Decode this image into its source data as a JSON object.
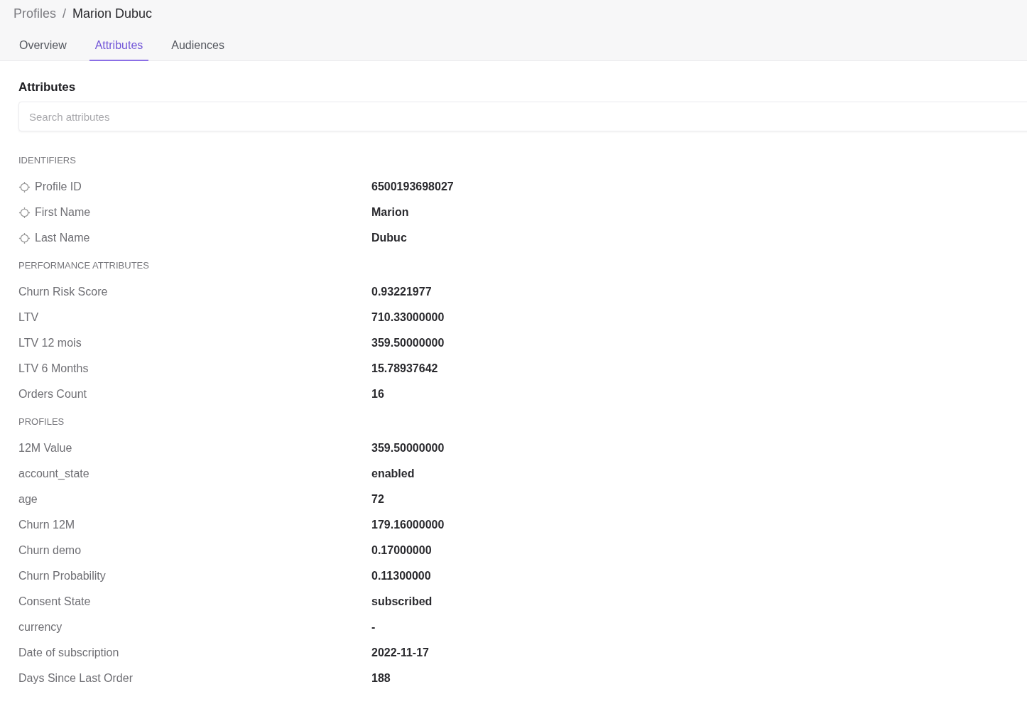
{
  "breadcrumb": {
    "parent": "Profiles",
    "separator": "/",
    "current": "Marion Dubuc"
  },
  "tabs": [
    {
      "label": "Overview",
      "selected": false
    },
    {
      "label": "Attributes",
      "selected": true
    },
    {
      "label": "Audiences",
      "selected": false
    }
  ],
  "panel": {
    "title": "Attributes",
    "search": {
      "placeholder": "Search attributes"
    },
    "sections": [
      {
        "title": "IDENTIFIERS",
        "kind": "identifier",
        "rows": [
          {
            "label": "Profile ID",
            "value": "6500193698027"
          },
          {
            "label": "First Name",
            "value": "Marion"
          },
          {
            "label": "Last Name",
            "value": "Dubuc"
          }
        ]
      },
      {
        "title": "PERFORMANCE ATTRIBUTES",
        "kind": "plain",
        "rows": [
          {
            "label": "Churn Risk Score",
            "value": "0.93221977"
          },
          {
            "label": "LTV",
            "value": "710.33000000"
          },
          {
            "label": "LTV 12 mois",
            "value": "359.50000000"
          },
          {
            "label": "LTV 6 Months",
            "value": "15.78937642"
          },
          {
            "label": "Orders Count",
            "value": "16"
          }
        ]
      },
      {
        "title": "PROFILES",
        "kind": "plain",
        "rows": [
          {
            "label": "12M Value",
            "value": "359.50000000"
          },
          {
            "label": "account_state",
            "value": "enabled"
          },
          {
            "label": "age",
            "value": "72"
          },
          {
            "label": "Churn 12M",
            "value": "179.16000000"
          },
          {
            "label": "Churn demo",
            "value": "0.17000000"
          },
          {
            "label": "Churn Probability",
            "value": "0.11300000"
          },
          {
            "label": "Consent State",
            "value": "subscribed"
          },
          {
            "label": "currency",
            "value": "-"
          },
          {
            "label": "Date of subscription",
            "value": "2022-11-17"
          },
          {
            "label": "Days Since Last Order",
            "value": "188"
          }
        ]
      }
    ]
  }
}
